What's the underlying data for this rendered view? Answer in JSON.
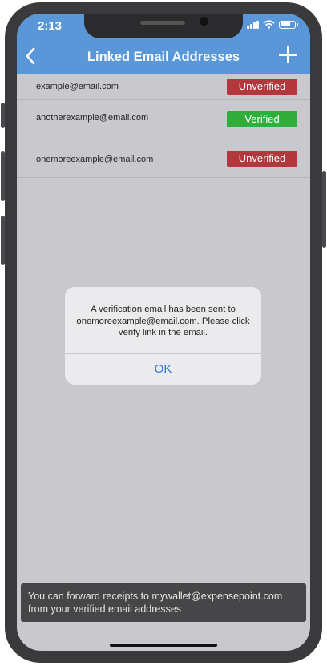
{
  "status_bar": {
    "time": "2:13"
  },
  "nav": {
    "title": "Linked Email Addresses",
    "back_glyph": "<",
    "add_icon": "plus-icon"
  },
  "emails": [
    {
      "address": "example@email.com",
      "status": "Unverified"
    },
    {
      "address": "anotherexample@email.com",
      "status": "Verified"
    },
    {
      "address": "onemoreexample@email.com",
      "status": "Unverified"
    }
  ],
  "alert": {
    "lines": [
      "A verification email has been sent to",
      "onemoreexample@email.com. Please click",
      "verify link in the email."
    ],
    "ok_label": "OK"
  },
  "toast": {
    "lines": [
      "You can forward receipts to mywallet@expensepoint.com",
      "from your verified email addresses"
    ]
  },
  "colors": {
    "header": "#5a97d8",
    "unverified": "#b2383e",
    "verified": "#2fae3c",
    "background_overlay": "#c9c8cc",
    "link": "#2f7ad9"
  }
}
